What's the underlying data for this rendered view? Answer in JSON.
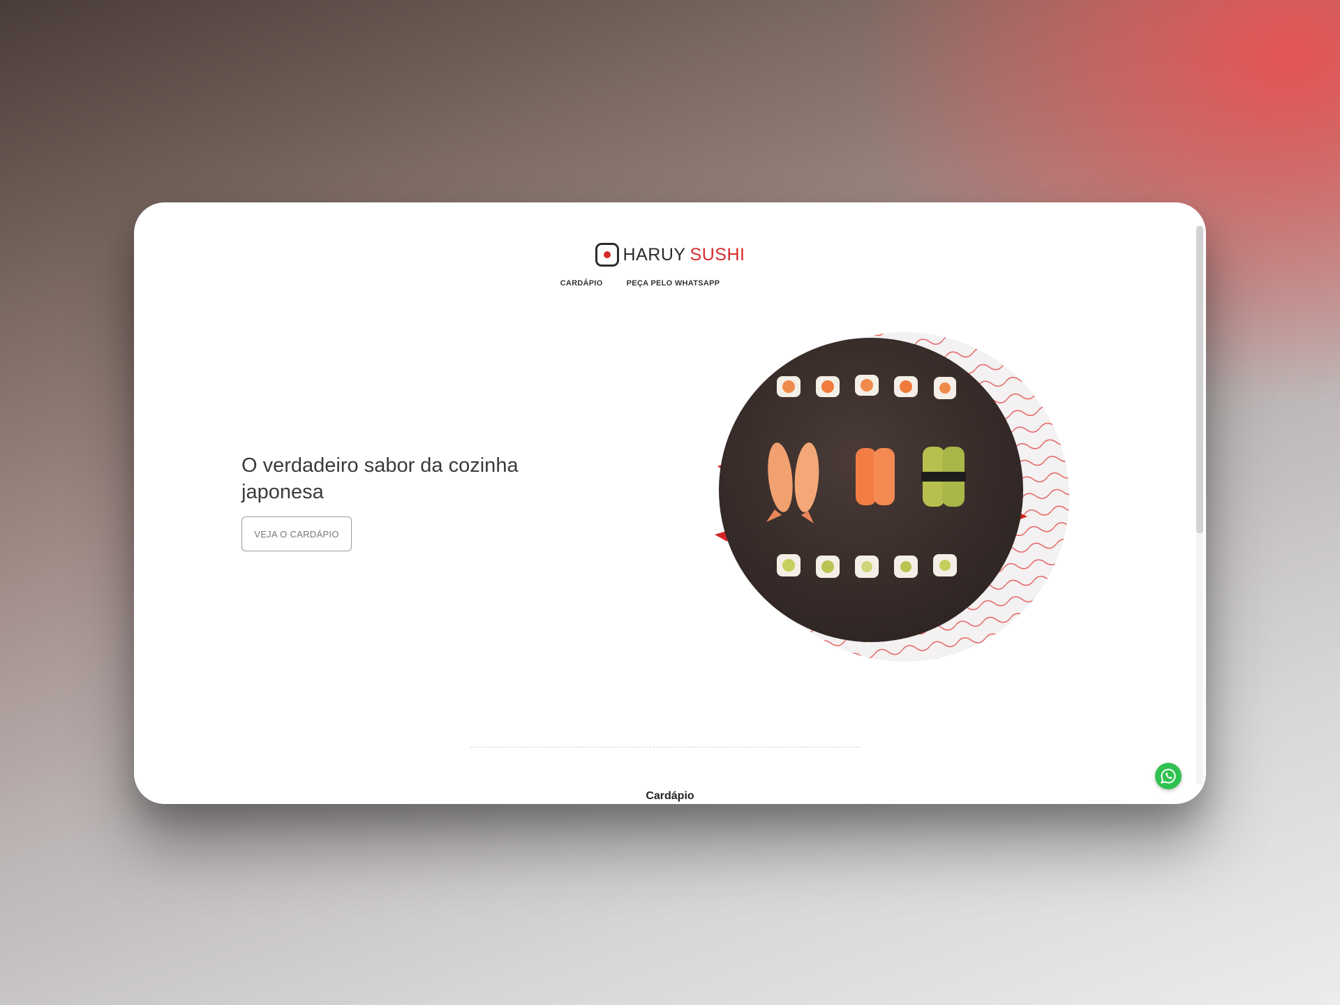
{
  "brand": {
    "name_primary": "HARUY",
    "name_accent": "SUSHI",
    "accent_color": "#d52b2b",
    "logo_icon": "square-dot-logo-icon"
  },
  "nav": {
    "items": [
      {
        "label": "CARDÁPIO"
      },
      {
        "label": "PEÇA PELO WHATSAPP"
      }
    ]
  },
  "hero": {
    "headline": "O verdadeiro sabor da cozinha japonesa",
    "cta_label": "VEJA O CARDÁPIO",
    "image": "sushi-platter-image"
  },
  "menu_section": {
    "title": "Cardápio"
  },
  "floating": {
    "whatsapp_icon": "whatsapp-icon",
    "whatsapp_color": "#2fc14f"
  }
}
